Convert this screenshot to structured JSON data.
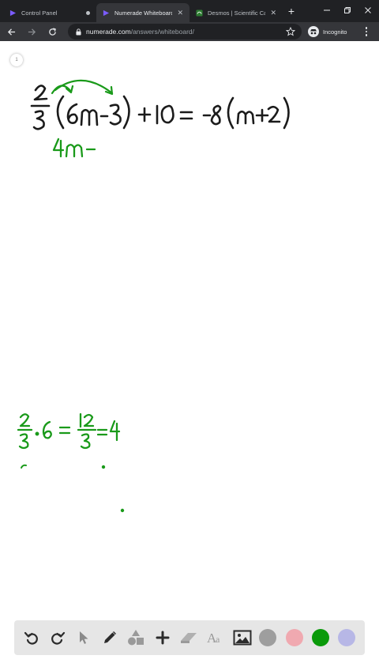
{
  "browser": {
    "tabs": [
      {
        "label": "Control Panel",
        "active": false
      },
      {
        "label": "Numerade Whiteboard",
        "active": true
      },
      {
        "label": "Desmos | Scientific Calcula",
        "active": false
      }
    ],
    "address": {
      "domain": "numerade.com",
      "path": "/answers/whiteboard/"
    },
    "profile_label": "Incognito"
  },
  "whiteboard": {
    "page_number": "1",
    "ink_color": "#1a9a1a",
    "ink_black": "#1b1b1b",
    "equation": "2/3(6m-3) + 10 = -8(m+2)",
    "step_1": "4m -",
    "side_work": "2/3 · 6 = 12/3 = 4"
  },
  "tools": {
    "icons": [
      "undo-icon",
      "redo-icon",
      "pointer-icon",
      "pen-icon",
      "shapes-icon",
      "add-icon",
      "eraser-icon",
      "text-icon",
      "image-icon"
    ],
    "colors": [
      "#9e9e9e",
      "#f0a9b0",
      "#0a9a0a",
      "#b7b7e6"
    ]
  }
}
